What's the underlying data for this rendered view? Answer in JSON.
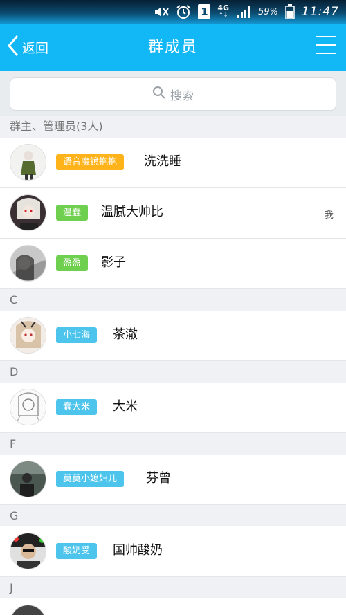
{
  "status_bar": {
    "network": "4G",
    "network_sub": "↑↓",
    "battery_percent": "59%",
    "time": "11:47",
    "sim_slot": "1",
    "icons": [
      "mute-icon",
      "alarm-icon",
      "sim-icon",
      "signal-icon",
      "battery-icon"
    ]
  },
  "header": {
    "back_label": "返回",
    "title": "群成员",
    "menu_icon": "hamburger-menu-icon"
  },
  "search": {
    "placeholder": "搜索"
  },
  "sections": [
    {
      "title": "群主、管理员(3人)",
      "members": [
        {
          "badge": "语音魔镜抱抱",
          "badge_color": "orange",
          "name": "洗洗睡"
        },
        {
          "badge": "温蠢",
          "badge_color": "green",
          "name": "温腻大帅比",
          "me_tag": "我"
        },
        {
          "badge": "盈盈",
          "badge_color": "green",
          "name": "影子"
        }
      ]
    },
    {
      "title": "C",
      "members": [
        {
          "badge": "小七海",
          "badge_color": "blue",
          "name": "茶澈"
        }
      ]
    },
    {
      "title": "D",
      "members": [
        {
          "badge": "蠢大米",
          "badge_color": "blue",
          "name": "大米"
        }
      ]
    },
    {
      "title": "F",
      "members": [
        {
          "badge": "莫莫小媳妇儿",
          "badge_color": "blue",
          "name": "芬曾"
        }
      ]
    },
    {
      "title": "G",
      "members": [
        {
          "badge": "酸奶受",
          "badge_color": "blue",
          "name": "国帅酸奶"
        }
      ]
    },
    {
      "title": "J",
      "members": []
    }
  ],
  "colors": {
    "header_bg": "#12b7f5",
    "badge_orange": "#ffb31a",
    "badge_green": "#6fcf4f",
    "badge_blue": "#4dc4ec"
  }
}
